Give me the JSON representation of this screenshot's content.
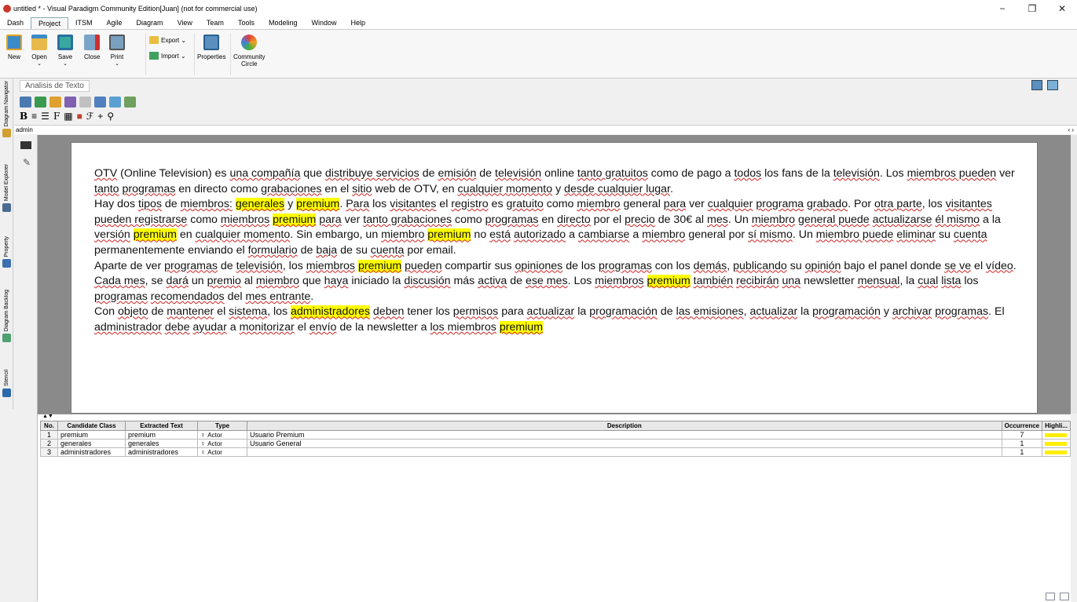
{
  "window": {
    "title": "untitled * - Visual Paradigm Community Edition[Juan] (not for commercial use)",
    "min_label": "−",
    "max_label": "❐",
    "close_label": "✕"
  },
  "menu": [
    "Dash",
    "Project",
    "ITSM",
    "Agile",
    "Diagram",
    "View",
    "Team",
    "Tools",
    "Modeling",
    "Window",
    "Help"
  ],
  "ribbon": {
    "new": "New",
    "open": "Open",
    "save": "Save",
    "close": "Close",
    "print": "Print",
    "export": "Export",
    "import": "Import",
    "properties": "Properties",
    "community_1": "Community",
    "community_2": "Circle"
  },
  "side_tabs": [
    "Diagram Navigator",
    "Model Explorer",
    "Property",
    "Diagram Backlog",
    "Stencil"
  ],
  "breadcrumb": "Analisis de Texto",
  "user": "admin",
  "document_text": "OTV (Online Television) es una compañía que distribuye servicios de emisión de televisión online tanto gratuitos como de pago a todos los fans de la televisión. Los miembros pueden ver tanto programas en directo como grabaciones en el sitio web de OTV, en cualquier momento y desde cualquier lugar. Hay dos tipos de miembros: generales y premium. Para los visitantes el registro es gratuito como miembro general para ver cualquier programa grabado. Por otra parte, los visitantes pueden registrarse como miembros premium para ver tanto grabaciones como programas en directo por el precio de 30€ al mes. Un miembro general puede actualizarse él mismo a la versión premium en cualquier momento. Sin embargo, un miembro premium no está autorizado a cambiarse a miembro general por sí mismo. Un miembro puede eliminar su cuenta permanentemente enviando el formulario de baja de su cuenta por email. Aparte de ver programas de televisión, los miembros premium pueden compartir sus opiniones de los programas con los demás, publicando su opinión bajo el panel donde se ve el vídeo. Cada mes, se dará un premio al miembro que haya iniciado la discusión más activa de ese mes. Los miembros premium también recibirán una newsletter mensual, la cual lista los programas recomendados del mes entrante. Con objeto de mantener el sistema, los administradores deben tener los permisos para actualizar la programación de las emisiones, actualizar la programación y archivar programas. El administrador debe ayudar a monitorizar el envío de la newsletter a los miembros premium",
  "table": {
    "columns": [
      "No.",
      "Candidate Class",
      "Extracted Text",
      "Type",
      "Description",
      "Occurrence",
      "Highli..."
    ],
    "rows": [
      {
        "no": "1",
        "candidate": "premium",
        "extracted": "premium",
        "type": "Actor",
        "description": "Usuario Premium",
        "occurrence": "7"
      },
      {
        "no": "2",
        "candidate": "generales",
        "extracted": "generales",
        "type": "Actor",
        "description": "Usuario General",
        "occurrence": "1"
      },
      {
        "no": "3",
        "candidate": "administradores",
        "extracted": "administradores",
        "type": "Actor",
        "description": "",
        "occurrence": "1"
      }
    ]
  },
  "colors": {
    "highlight": "#ffff00",
    "canvas": "#8a8a8a"
  }
}
